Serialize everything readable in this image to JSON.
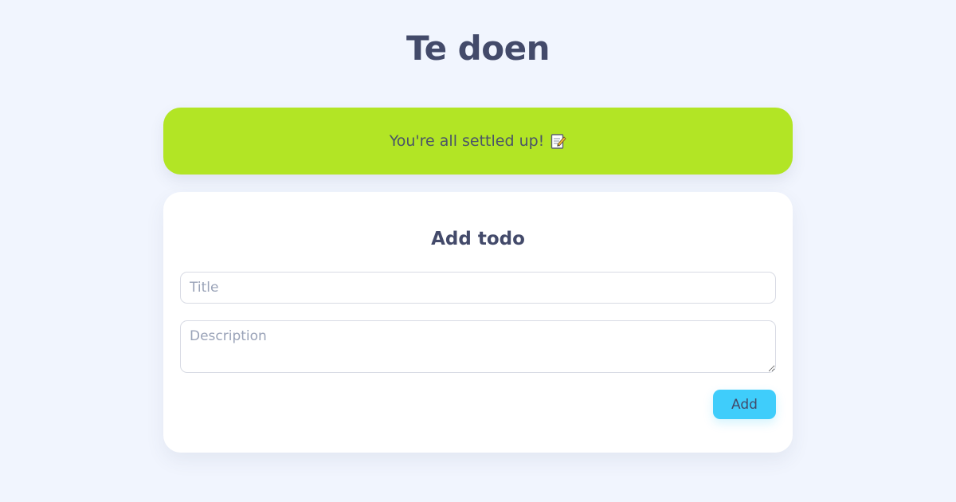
{
  "header": {
    "title": "Te doen"
  },
  "status": {
    "message": "You're all settled up!",
    "icon": "memo-icon",
    "color": "#b2e525"
  },
  "form": {
    "title": "Add todo",
    "title_field": {
      "placeholder": "Title",
      "value": ""
    },
    "description_field": {
      "placeholder": "Description",
      "value": ""
    },
    "add_button_label": "Add",
    "accent_color": "#3fcdfb"
  }
}
